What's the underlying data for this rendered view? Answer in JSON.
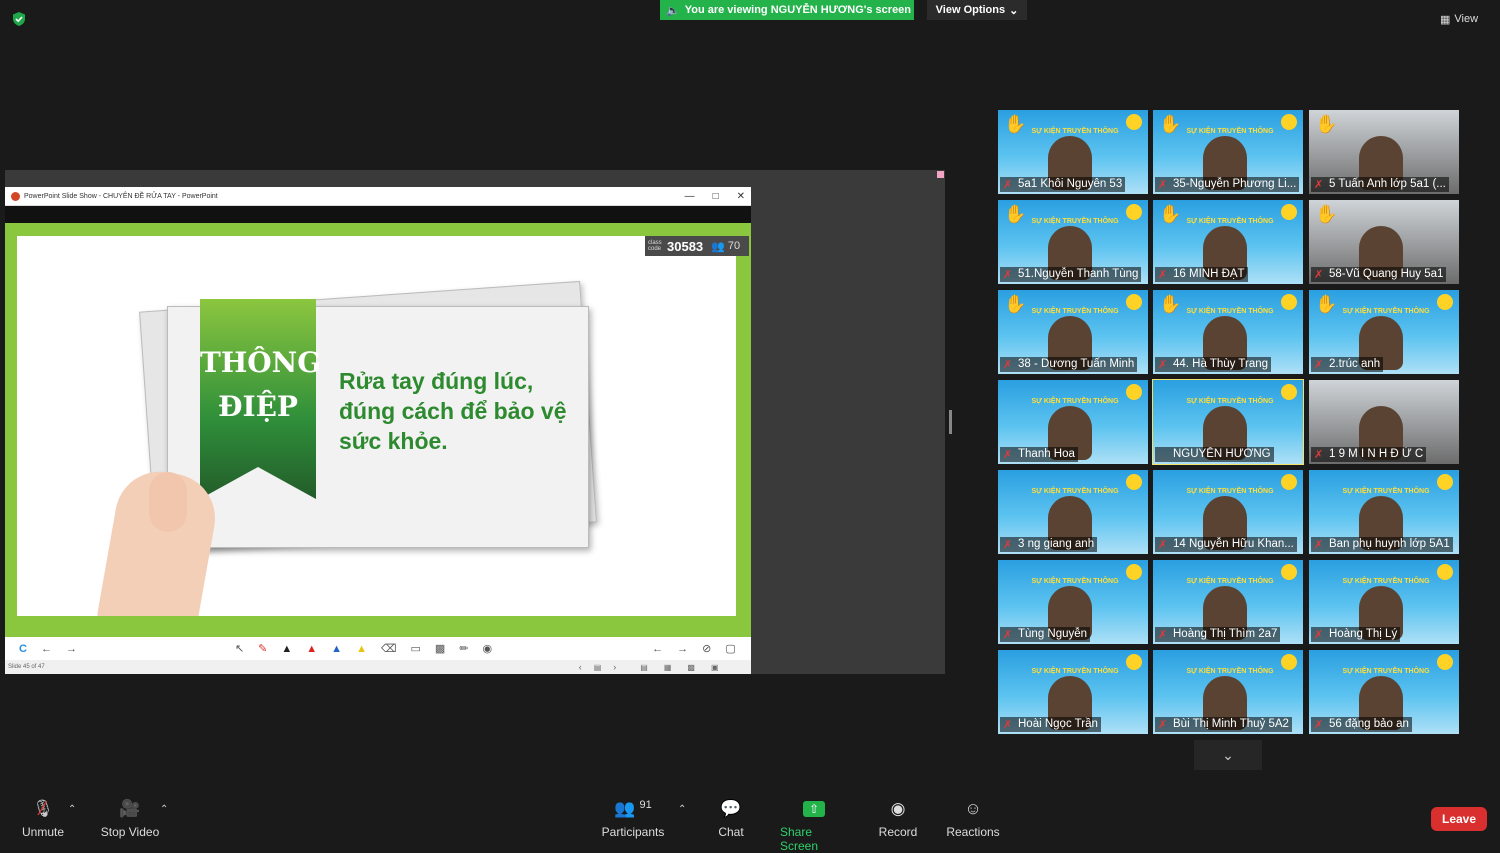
{
  "top_bar": {
    "viewing_text": "You are viewing NGUYỄN HƯƠNG's screen",
    "view_options_label": "View Options",
    "view_label": "View",
    "accent_color": "#24b24b"
  },
  "powerpoint": {
    "window_title": "PowerPoint Slide Show  -  CHUYÊN ĐỀ RỬA TAY  -  PowerPoint",
    "class_code_label": "class code",
    "class_code": "30583",
    "attendee_count": "70",
    "slide_heading_line1": "THÔNG",
    "slide_heading_line2": "ĐIỆP",
    "slide_message": "Rửa tay đúng lúc, đúng cách để bảo vệ sức khỏe.",
    "status_text": "Slide 45 of 47"
  },
  "participants_grid": {
    "tile_banner": "SỰ KIỆN TRUYỀN THÔNG",
    "tiles": [
      {
        "name": "5a1 Khôi Nguyên 53",
        "muted": true,
        "hand": true
      },
      {
        "name": "35-Nguyễn Phương Li...",
        "muted": true,
        "hand": true
      },
      {
        "name": "5 Tuấn Anh lớp 5a1 (...",
        "muted": true,
        "hand": true
      },
      {
        "name": "51.Nguyễn Thanh Tùng",
        "muted": true,
        "hand": true
      },
      {
        "name": "16 MINH ĐẠT",
        "muted": true,
        "hand": true
      },
      {
        "name": "58-Vũ Quang Huy 5a1",
        "muted": true,
        "hand": true
      },
      {
        "name": "38 - Dương Tuấn Minh",
        "muted": true,
        "hand": true
      },
      {
        "name": "44. Hà Thùy Trang",
        "muted": true,
        "hand": true
      },
      {
        "name": "2.trúc anh",
        "muted": true,
        "hand": true
      },
      {
        "name": "Thanh Hoa",
        "muted": true,
        "hand": false
      },
      {
        "name": "NGUYỄN HƯƠNG",
        "muted": false,
        "hand": false
      },
      {
        "name": "1 9 M I N H Đ Ứ C",
        "muted": true,
        "hand": false
      },
      {
        "name": "3 ng giang anh",
        "muted": true,
        "hand": false
      },
      {
        "name": "14 Nguyễn Hữu Khan...",
        "muted": true,
        "hand": false
      },
      {
        "name": "Ban phụ huynh lớp 5A1",
        "muted": true,
        "hand": false
      },
      {
        "name": "Tùng Nguyễn",
        "muted": true,
        "hand": false
      },
      {
        "name": "Hoàng Thị Thìm 2a7",
        "muted": true,
        "hand": false
      },
      {
        "name": "Hoàng Thị Lý",
        "muted": true,
        "hand": false
      },
      {
        "name": "Hoài Ngọc Trần",
        "muted": true,
        "hand": false
      },
      {
        "name": "Bùi Thị Minh Thuỷ 5A2",
        "muted": true,
        "hand": false
      },
      {
        "name": "56 đặng  bảo an",
        "muted": true,
        "hand": false
      }
    ]
  },
  "toolbar": {
    "unmute_label": "Unmute",
    "stop_video_label": "Stop Video",
    "participants_label": "Participants",
    "participants_count": "91",
    "chat_label": "Chat",
    "share_screen_label": "Share Screen",
    "record_label": "Record",
    "reactions_label": "Reactions",
    "leave_label": "Leave",
    "leave_color": "#d9302f"
  }
}
